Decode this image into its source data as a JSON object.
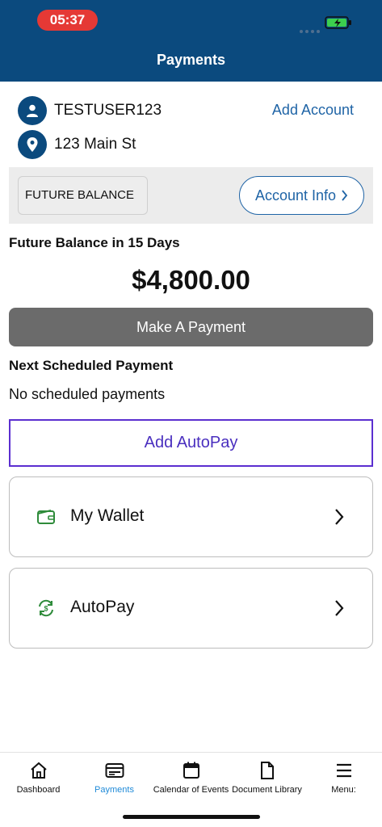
{
  "status_bar": {
    "time": "05:37"
  },
  "header": {
    "title": "Payments"
  },
  "account": {
    "username": "TESTUSER123",
    "address": "123 Main St",
    "add_account_label": "Add Account"
  },
  "balance_band": {
    "future_balance_label": "FUTURE BALANCE",
    "account_info_label": "Account Info"
  },
  "balance": {
    "heading": "Future Balance in 15 Days",
    "amount": "$4,800.00",
    "make_payment_label": "Make A Payment"
  },
  "scheduled": {
    "heading": "Next Scheduled Payment",
    "status": "No scheduled payments",
    "add_autopay_label": "Add AutoPay"
  },
  "cards": [
    {
      "label": "My Wallet",
      "icon": "wallet-icon"
    },
    {
      "label": "AutoPay",
      "icon": "autopay-cycle-icon"
    }
  ],
  "tabbar": {
    "active": "Payments",
    "items": [
      {
        "label": "Dashboard",
        "icon": "home-icon"
      },
      {
        "label": "Payments",
        "icon": "payment-card-icon"
      },
      {
        "label": "Calendar of Events",
        "icon": "calendar-icon"
      },
      {
        "label": "Document Library",
        "icon": "document-icon"
      },
      {
        "label": "Menu:",
        "icon": "hamburger-menu-icon"
      }
    ]
  },
  "colors": {
    "header_bg": "#0b4a7e",
    "link_blue": "#1f64a6",
    "autopay_purple": "#5b2fd0",
    "icon_green": "#2e8b3a",
    "active_tab": "#1f8ad8",
    "button_gray": "#6b6b6b"
  }
}
